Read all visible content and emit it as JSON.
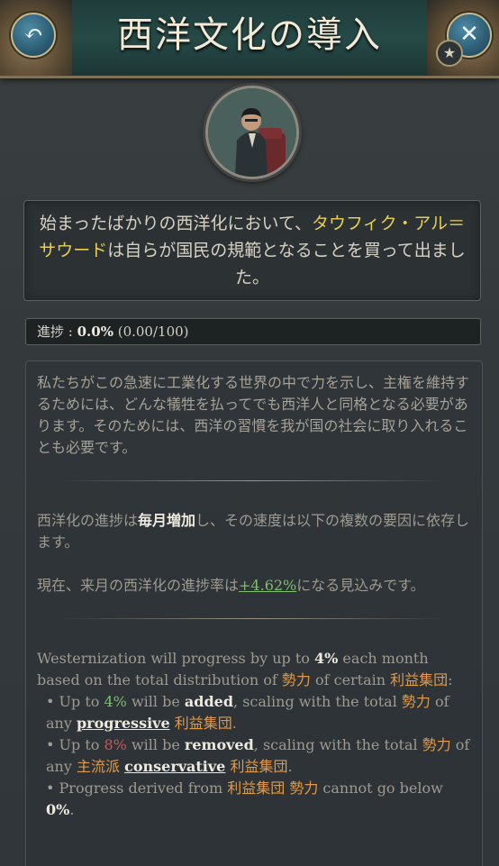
{
  "title": "西洋文化の導入",
  "icons": {
    "back": "back-arrow-icon",
    "close": "close-icon",
    "star": "star-icon",
    "portrait": "character-portrait"
  },
  "description": {
    "part1": "始まったばかりの西洋化において、",
    "name": "タウフィク・アル＝サウード",
    "part2": "は自らが国民の規範となることを買って出ました。"
  },
  "progress": {
    "label": "進捗 : ",
    "percent_text": "0.0%",
    "ratio_text": " (0.00/100)",
    "fraction": 0.0
  },
  "body": {
    "intro": "私たちがこの急速に工業化する世界の中で力を示し、主権を維持するためには、どんな犠牲を払ってでも西洋人と同格となる必要があります。そのためには、西洋の習慣を我が国の社会に取り入れることも必要です。",
    "progress_p1": "西洋化の進捗は",
    "progress_bold": "毎月増加",
    "progress_p2": "し、その速度は以下の複数の要因に依存します。",
    "rate_p1": "現在、来月の西洋化の進捗率は",
    "rate_value": "+4.62%",
    "rate_p2": "になる見込みです。",
    "en_line1_a": "Westernization will progress by up to ",
    "en_line1_pct": "4%",
    "en_line1_b": " each month based on the total distribution of ",
    "clout": "勢力",
    "en_line1_c": " of certain ",
    "interest_groups": "利益集団",
    "en_line1_d": ":",
    "b1_a": "Up to ",
    "b1_pct": "4%",
    "b1_b": " will be ",
    "b1_added": "added",
    "b1_c": ", scaling with the total ",
    "b1_d": " of any ",
    "b1_progressive": "progressive",
    "b2_a": "Up to ",
    "b2_pct": "8%",
    "b2_b": " will be ",
    "b2_removed": "removed",
    "b2_c": ", scaling with the total ",
    "b2_d": " of any ",
    "b2_mainstream": "主流派",
    "b2_conservative": "conservative",
    "b3_a": "Progress derived from ",
    "b3_b": " cannot go below ",
    "b3_zero": "0%",
    "b3_end": ".",
    "bullet": "•",
    "space": " ",
    "period": "."
  },
  "colors": {
    "accent_yellow": "#e6cf56",
    "positive_green": "#7cc06b",
    "negative_red": "#d25454",
    "keyword_orange": "#e19a49",
    "title_bar": "#264a47"
  }
}
